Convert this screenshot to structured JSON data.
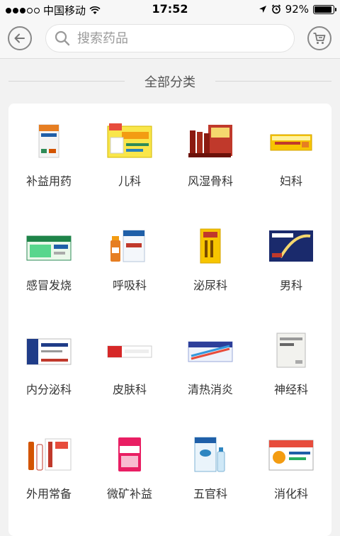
{
  "status_bar": {
    "carrier": "中国移动",
    "time": "17:52",
    "battery": "92%",
    "battery_level": 0.92
  },
  "header": {
    "search_placeholder": "搜索药品",
    "back_icon": "back-arrow-icon",
    "cart_icon": "cart-icon"
  },
  "section_title": "全部分类",
  "categories": [
    {
      "label": "补益用药"
    },
    {
      "label": "儿科"
    },
    {
      "label": "风湿骨科"
    },
    {
      "label": "妇科"
    },
    {
      "label": "感冒发烧"
    },
    {
      "label": "呼吸科"
    },
    {
      "label": "泌尿科"
    },
    {
      "label": "男科"
    },
    {
      "label": "内分泌科"
    },
    {
      "label": "皮肤科"
    },
    {
      "label": "清热消炎"
    },
    {
      "label": "神经科"
    },
    {
      "label": "外用常备"
    },
    {
      "label": "微矿补益"
    },
    {
      "label": "五官科"
    },
    {
      "label": "消化科"
    }
  ]
}
